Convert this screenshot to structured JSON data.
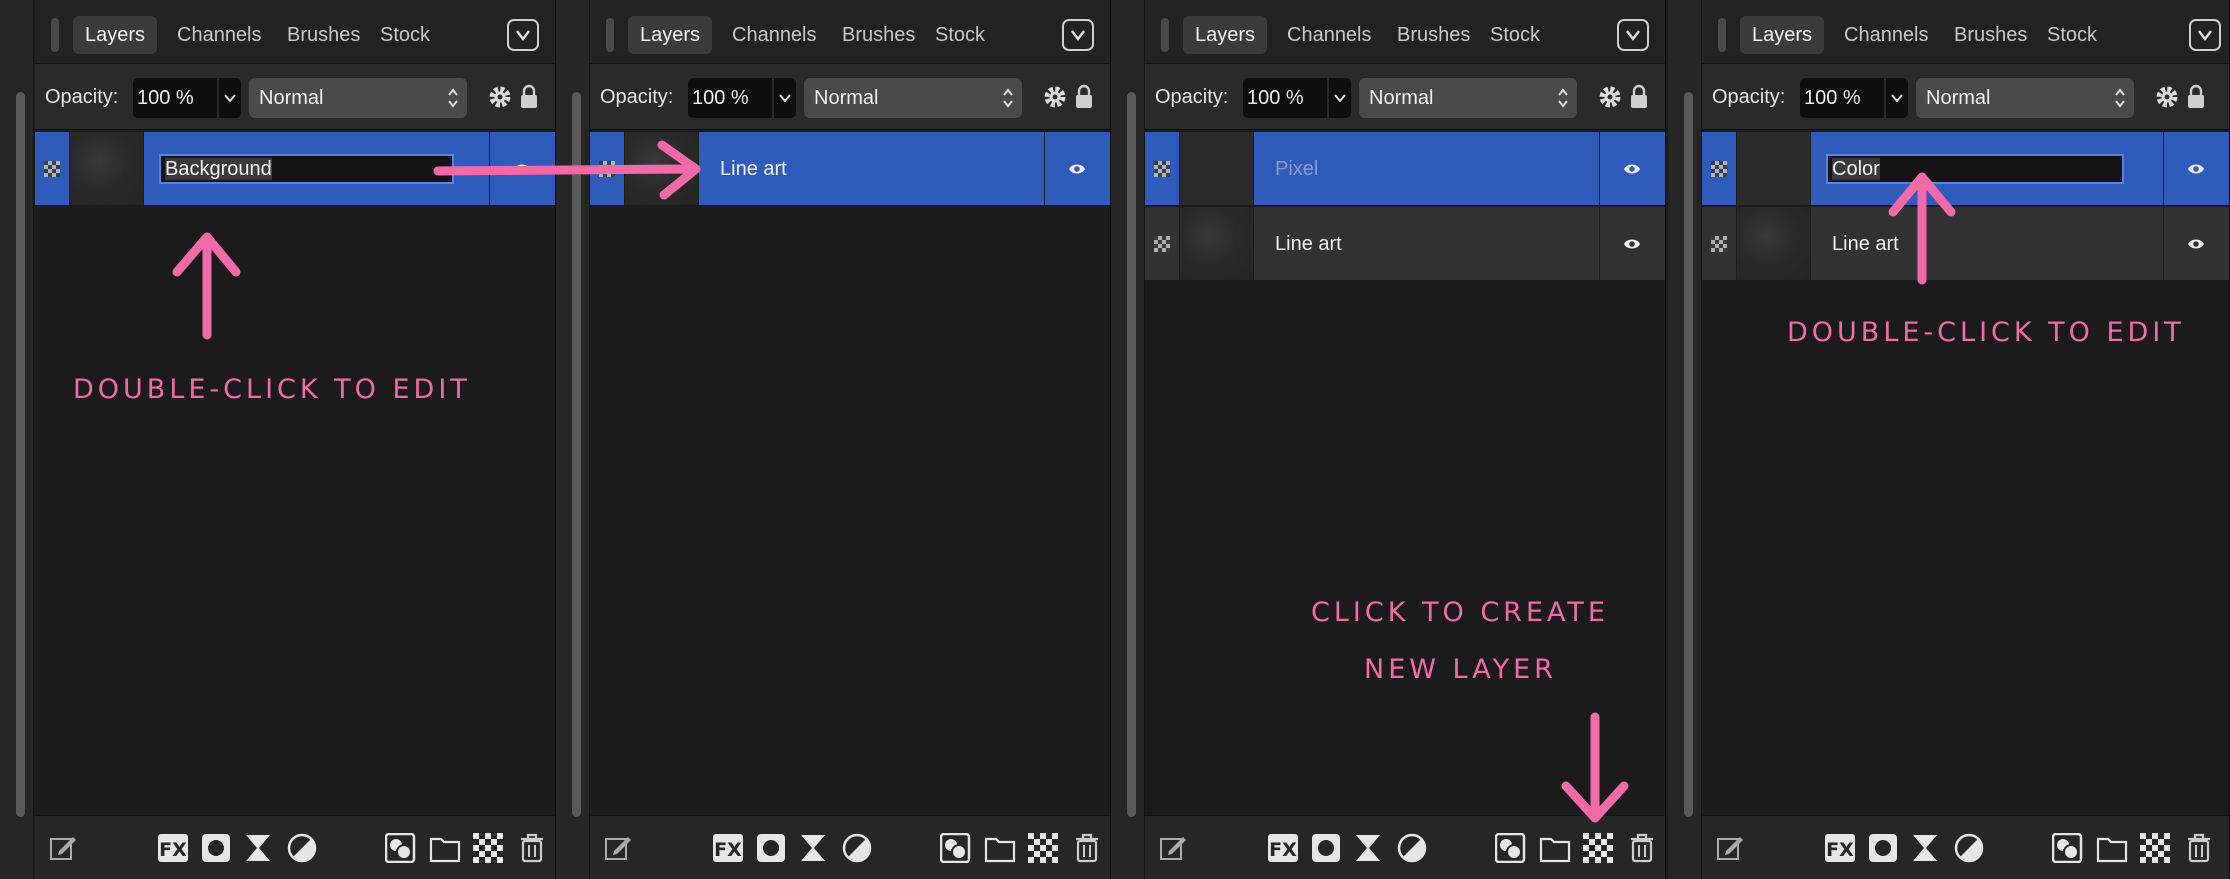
{
  "panel": {
    "tabs": [
      "Layers",
      "Channels",
      "Brushes",
      "Stock"
    ],
    "opacity_label": "Opacity:",
    "opacity_value": "100 %",
    "blend_mode": "Normal"
  },
  "panels": [
    {
      "layers": [
        {
          "name": "Background",
          "editing": true,
          "selected": true
        }
      ]
    },
    {
      "layers": [
        {
          "name": "Line art",
          "editing": false,
          "selected": true
        }
      ]
    },
    {
      "layers": [
        {
          "name": "Pixel",
          "editing": false,
          "selected": true
        },
        {
          "name": "Line art",
          "editing": false,
          "selected": false
        }
      ]
    },
    {
      "layers": [
        {
          "name": "Color",
          "editing": true,
          "selected": true
        },
        {
          "name": "Line art",
          "editing": false,
          "selected": false
        }
      ]
    }
  ],
  "annotations": {
    "double_click_1": "Double-click to edit",
    "double_click_2": "Double-click to edit",
    "create_line1": "Click to create",
    "create_line2": "new layer"
  },
  "colors": {
    "selection": "#2f5bba",
    "annotation": "#f26aa8",
    "panel_bg": "#1b1b1c"
  }
}
